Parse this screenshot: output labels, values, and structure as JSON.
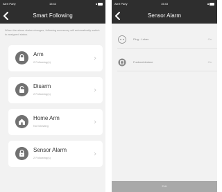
{
  "left_screen": {
    "statusbar": {
      "carrier": "Alert Party",
      "time": "15:42"
    },
    "title": "Smart Following",
    "info_text": "When the alarm status changes, following accessory will automatically switch to assigned status.",
    "modes": [
      {
        "title": "Arm",
        "subtitle": "2 Following(s)",
        "icon": "lock-closed-icon"
      },
      {
        "title": "Disarm",
        "subtitle": "2 Following(s)",
        "icon": "lock-open-icon"
      },
      {
        "title": "Home Arm",
        "subtitle": "No following",
        "icon": "home-lock-icon"
      },
      {
        "title": "Sensor Alarm",
        "subtitle": "2 Following(s)",
        "icon": "alarm-lock-icon"
      }
    ]
  },
  "right_screen": {
    "statusbar": {
      "carrier": "Alert Party",
      "time": "15:43"
    },
    "title": "Sensor Alarm",
    "sensors": [
      {
        "name": "Plug - Lukas",
        "state": "On",
        "icon": "plug-icon"
      },
      {
        "name": "Funkmeldedose",
        "state": "On",
        "icon": "switch-icon"
      }
    ],
    "edit_label": "Edit"
  },
  "colors": {
    "nav_background": "#2e2e2e",
    "screen_background": "#f2f2f2",
    "card_background": "#ffffff",
    "icon_circle": "#717171",
    "edit_bar": "#a9a9a9"
  }
}
